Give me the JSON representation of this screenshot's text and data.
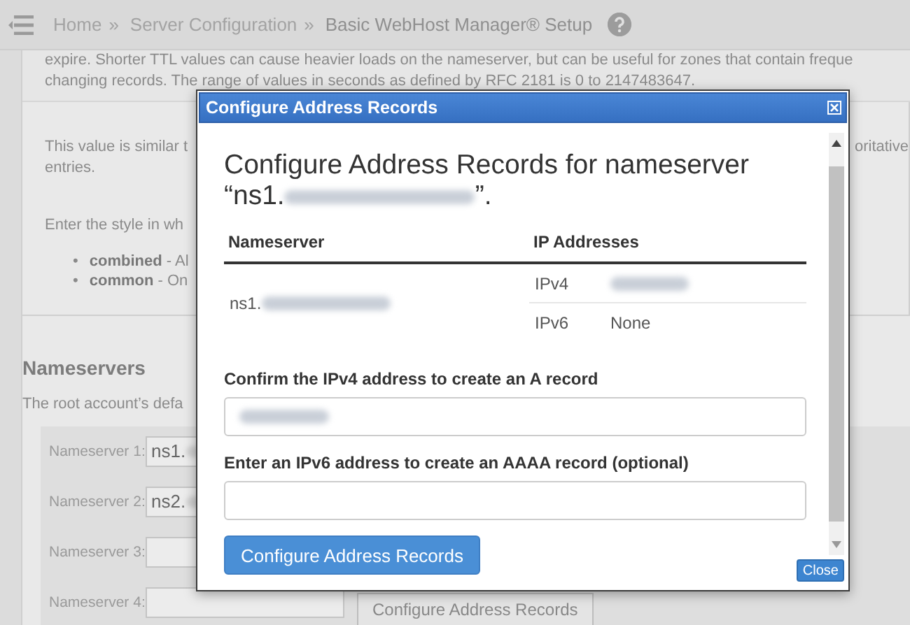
{
  "header": {
    "breadcrumbs": [
      {
        "label": "Home"
      },
      {
        "label": "Server Configuration"
      },
      {
        "label": "Basic WebHost Manager® Setup"
      }
    ],
    "separators": [
      "»",
      "»"
    ]
  },
  "background": {
    "ttl_lines": [
      "expire. Shorter TTL values can cause heavier loads on the nameserver, but can be useful for zones that contain freque",
      "changing records. The range of values in seconds as defined by RFC 2181 is 0 to 2147483647."
    ],
    "similar_text": "This value is similar t",
    "similar_right": "oritative",
    "entries_text": "entries.",
    "style_prompt": "Enter the style in wh",
    "style_options": [
      {
        "marker": "•",
        "term": "combined",
        "desc": " - Al"
      },
      {
        "marker": "•",
        "term": "common",
        "desc": " - On"
      }
    ],
    "nameservers_heading": "Nameservers",
    "nameservers_intro": "The root account’s defa",
    "nameserver_fields": [
      {
        "label": "Nameserver 1:",
        "value": "ns1.",
        "redacted": true
      },
      {
        "label": "Nameserver 2:",
        "value": "ns2.",
        "redacted": true
      },
      {
        "label": "Nameserver 3:"
      },
      {
        "label": "Nameserver 4:"
      }
    ],
    "configure_button": "Configure Address Records"
  },
  "dialog": {
    "title": "Configure Address Records",
    "heading_line1": "Configure Address Records for nameserver",
    "heading_line2": "“ns1.",
    "heading_end": "”.",
    "heading_redacted": true,
    "columns": [
      "Nameserver",
      "IP Addresses"
    ],
    "nameserver": "ns1.",
    "nameserver_redacted": true,
    "addresses": [
      {
        "type": "IPv4",
        "redacted": true
      },
      {
        "type": "IPv6",
        "value": "None",
        "redacted": false
      }
    ],
    "ipv4_label": "Confirm the IPv4 address to create an A record",
    "ipv4_redacted": true,
    "ipv6_label": "Enter an IPv6 address to create an AAAA record (optional)",
    "submit_button": "Configure Address Records",
    "close_button": "Close"
  }
}
